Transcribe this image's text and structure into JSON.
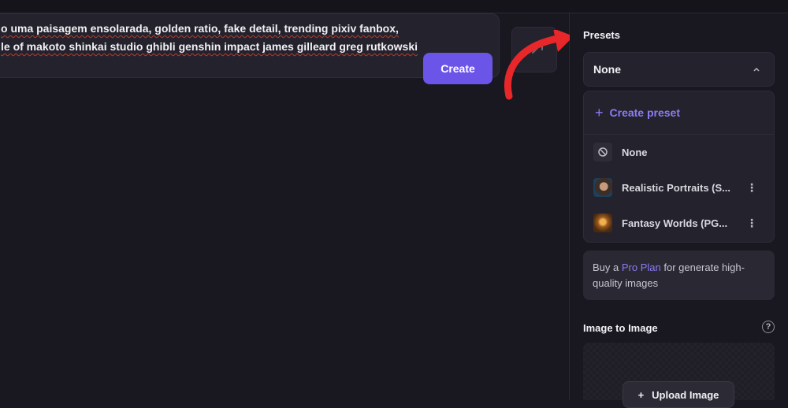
{
  "prompt": {
    "line1": "o uma paisagem ensolarada, golden ratio, fake detail, trending pixiv fanbox,",
    "line2": "le of makoto shinkai studio ghibli genshin impact james gilleard greg rutkowski",
    "create_label": "Create"
  },
  "sidebar": {
    "presets_title": "Presets",
    "selected_preset": "None",
    "create_preset_label": "Create preset",
    "preset_items": [
      {
        "label": "None",
        "icon": "block-icon"
      },
      {
        "label": "Realistic Portraits (S...",
        "icon": "portrait-thumbnail"
      },
      {
        "label": "Fantasy Worlds (PG...",
        "icon": "fantasy-thumbnail"
      }
    ],
    "pro_text_before": "Buy a ",
    "pro_link": "Pro Plan",
    "pro_text_after": " for generate high-quality images",
    "image_to_image_title": "Image to Image",
    "help_symbol": "?",
    "upload_label": "Upload Image"
  },
  "colors": {
    "accent": "#6b54e8",
    "link": "#8a7cf4",
    "annotation_arrow": "#e8272a",
    "background": "#19171f"
  }
}
